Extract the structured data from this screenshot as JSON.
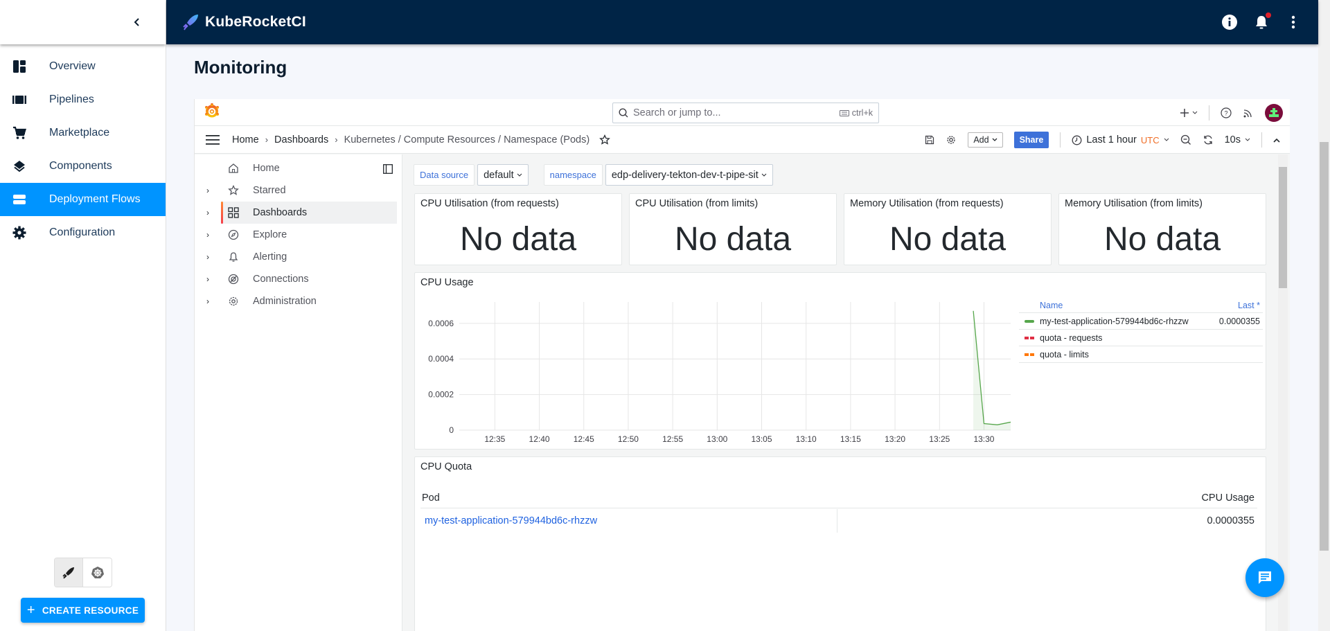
{
  "app": {
    "brand": "KubeRocketCI",
    "page_title": "Monitoring"
  },
  "sidebar": {
    "items": [
      {
        "label": "Overview",
        "icon": "dashboard-icon",
        "active": false
      },
      {
        "label": "Pipelines",
        "icon": "pipeline-icon",
        "active": false
      },
      {
        "label": "Marketplace",
        "icon": "cart-icon",
        "active": false
      },
      {
        "label": "Components",
        "icon": "layers-icon",
        "active": false
      },
      {
        "label": "Deployment Flows",
        "icon": "storage-icon",
        "active": true
      },
      {
        "label": "Configuration",
        "icon": "gear-icon",
        "active": false
      }
    ],
    "create_button": "CREATE RESOURCE"
  },
  "grafana": {
    "search_placeholder": "Search or jump to...",
    "search_shortcut": "ctrl+k",
    "breadcrumb": [
      "Home",
      "Dashboards",
      "Kubernetes / Compute Resources / Namespace (Pods)"
    ],
    "toolbar": {
      "add_label": "Add",
      "share_label": "Share",
      "time_range": "Last 1 hour",
      "timezone": "UTC",
      "refresh_interval": "10s"
    },
    "nav": [
      {
        "label": "Home",
        "expandable": false,
        "active": false
      },
      {
        "label": "Starred",
        "expandable": true,
        "active": false
      },
      {
        "label": "Dashboards",
        "expandable": true,
        "active": true
      },
      {
        "label": "Explore",
        "expandable": true,
        "active": false
      },
      {
        "label": "Alerting",
        "expandable": true,
        "active": false
      },
      {
        "label": "Connections",
        "expandable": true,
        "active": false
      },
      {
        "label": "Administration",
        "expandable": true,
        "active": false
      }
    ],
    "variables": {
      "datasource_label": "Data source",
      "datasource_value": "default",
      "namespace_label": "namespace",
      "namespace_value": "edp-delivery-tekton-dev-t-pipe-sit"
    },
    "stat_panels": [
      {
        "title": "CPU Utilisation (from requests)",
        "value": "No data"
      },
      {
        "title": "CPU Utilisation (from limits)",
        "value": "No data"
      },
      {
        "title": "Memory Utilisation (from requests)",
        "value": "No data"
      },
      {
        "title": "Memory Utilisation (from limits)",
        "value": "No data"
      }
    ],
    "cpu_quota": {
      "title": "CPU Quota",
      "columns": [
        "Pod",
        "CPU Usage"
      ],
      "rows": [
        {
          "pod": "my-test-application-579944bd6c-rhzzw",
          "cpu_usage": "0.0000355"
        }
      ]
    }
  },
  "chart_data": {
    "type": "line",
    "title": "CPU Usage",
    "xlabel": "",
    "ylabel": "",
    "x_tick_labels": [
      "12:35",
      "12:40",
      "12:45",
      "12:50",
      "12:55",
      "13:00",
      "13:05",
      "13:10",
      "13:15",
      "13:20",
      "13:25",
      "13:30"
    ],
    "y_tick_labels": [
      "0",
      "0.0002",
      "0.0004",
      "0.0006"
    ],
    "ylim": [
      0,
      0.00072
    ],
    "xlim_minutes": [
      "12:31",
      "13:33"
    ],
    "grid": true,
    "legend_placement": "right",
    "legend_headers": [
      "Name",
      "Last *"
    ],
    "series": [
      {
        "name": "my-test-application-579944bd6c-rhzzw",
        "color": "#56a64b",
        "style": "solid",
        "last": "0.0000355",
        "x": [
          "13:28.8",
          "13:30",
          "13:31.5",
          "13:33"
        ],
        "y": [
          0.00067,
          3.7e-05,
          3e-05,
          4.5e-05
        ]
      },
      {
        "name": "quota - requests",
        "color": "#e02f44",
        "style": "dashed",
        "last": "",
        "x": [],
        "y": []
      },
      {
        "name": "quota - limits",
        "color": "#ff780a",
        "style": "dashed",
        "last": "",
        "x": [],
        "y": []
      }
    ]
  }
}
